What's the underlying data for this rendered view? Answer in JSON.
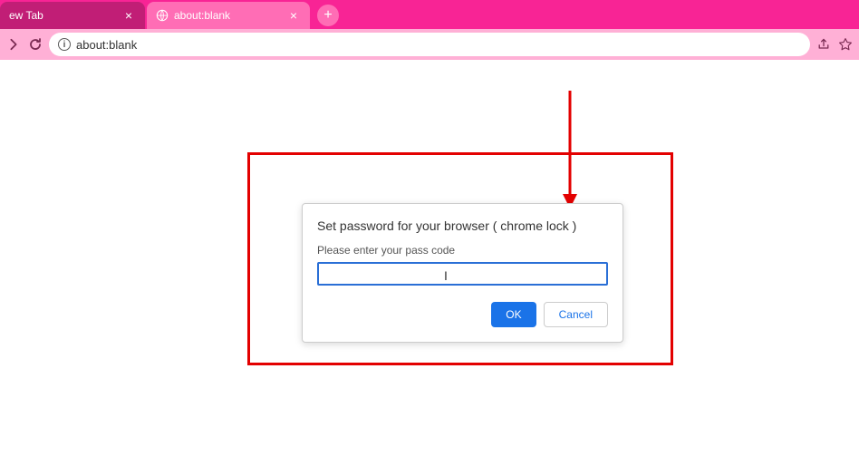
{
  "tabs": {
    "items": [
      {
        "title": "ew Tab",
        "active": false
      },
      {
        "title": "about:blank",
        "active": true
      }
    ],
    "close_glyph": "×",
    "new_tab_glyph": "+"
  },
  "toolbar": {
    "url": "about:blank",
    "site_info_glyph": "i"
  },
  "dialog": {
    "title": "Set password for your browser ( chrome lock )",
    "label": "Please enter your pass code",
    "input_value": "",
    "ok_label": "OK",
    "cancel_label": "Cancel"
  }
}
